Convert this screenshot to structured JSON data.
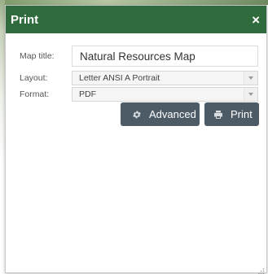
{
  "dialog": {
    "title": "Print",
    "close_label": "×",
    "accent_color": "#2f6b3d"
  },
  "form": {
    "map_title": {
      "label": "Map title:",
      "value": "Natural Resources Map"
    },
    "layout": {
      "label": "Layout:",
      "value": "Letter ANSI A Portrait"
    },
    "format": {
      "label": "Format:",
      "value": "PDF"
    }
  },
  "actions": {
    "advanced_label": "Advanced",
    "advanced_icon": "gear-icon",
    "print_label": "Print",
    "print_icon": "printer-icon",
    "button_color": "#4d5b66"
  }
}
